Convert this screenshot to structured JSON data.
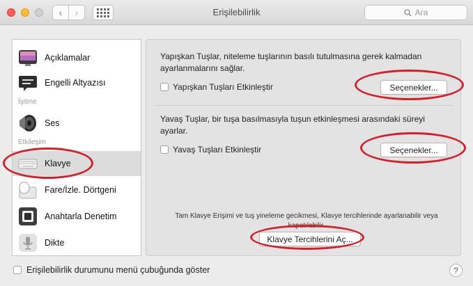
{
  "window": {
    "title": "Erişilebilirlik",
    "search_placeholder": "Ara",
    "back_glyph": "‹",
    "forward_glyph": "›"
  },
  "sidebar": {
    "sections": [
      "İşitme",
      "Etkileşim"
    ],
    "items": [
      {
        "label": "Açıklamalar",
        "icon": "descriptions-icon"
      },
      {
        "label": "Engelli Altyazısı",
        "icon": "captions-icon"
      },
      {
        "label": "Ses",
        "icon": "speaker-icon"
      },
      {
        "label": "Klavye",
        "icon": "keyboard-icon",
        "selected": true
      },
      {
        "label": "Fare/İzle. Dörtgeni",
        "icon": "mouse-trackpad-icon"
      },
      {
        "label": "Anahtarla Denetim",
        "icon": "switch-control-icon"
      },
      {
        "label": "Dikte",
        "icon": "microphone-icon"
      }
    ]
  },
  "panel": {
    "sticky": {
      "description": "Yapışkan Tuşlar, niteleme tuşlarının basılı tutulmasına gerek kalmadan ayarlanmalarını sağlar.",
      "checkbox_label": "Yapışkan Tuşları Etkinleştir",
      "checked": false,
      "options_label": "Seçenekler..."
    },
    "slow": {
      "description": "Yavaş Tuşlar, bir tuşa basılmasıyla tuşun etkinleşmesi arasındaki süreyi ayarlar.",
      "checkbox_label": "Yavaş Tuşları Etkinleştir",
      "checked": false,
      "options_label": "Seçenekler..."
    },
    "footnote": "Tam Klavye Erişimi ve tuş yineleme gecikmesi, Klavye tercihlerinde ayarlanabilir veya kapatılabilir.",
    "open_prefs_label": "Klavye Tercihlerini Aç..."
  },
  "bottom": {
    "checkbox_label": "Erişilebilirlik durumunu menü çubuğunda göster",
    "checked": false,
    "help_label": "?"
  },
  "colors": {
    "annotation": "#d4202a",
    "selection": "#dcdcdc"
  }
}
